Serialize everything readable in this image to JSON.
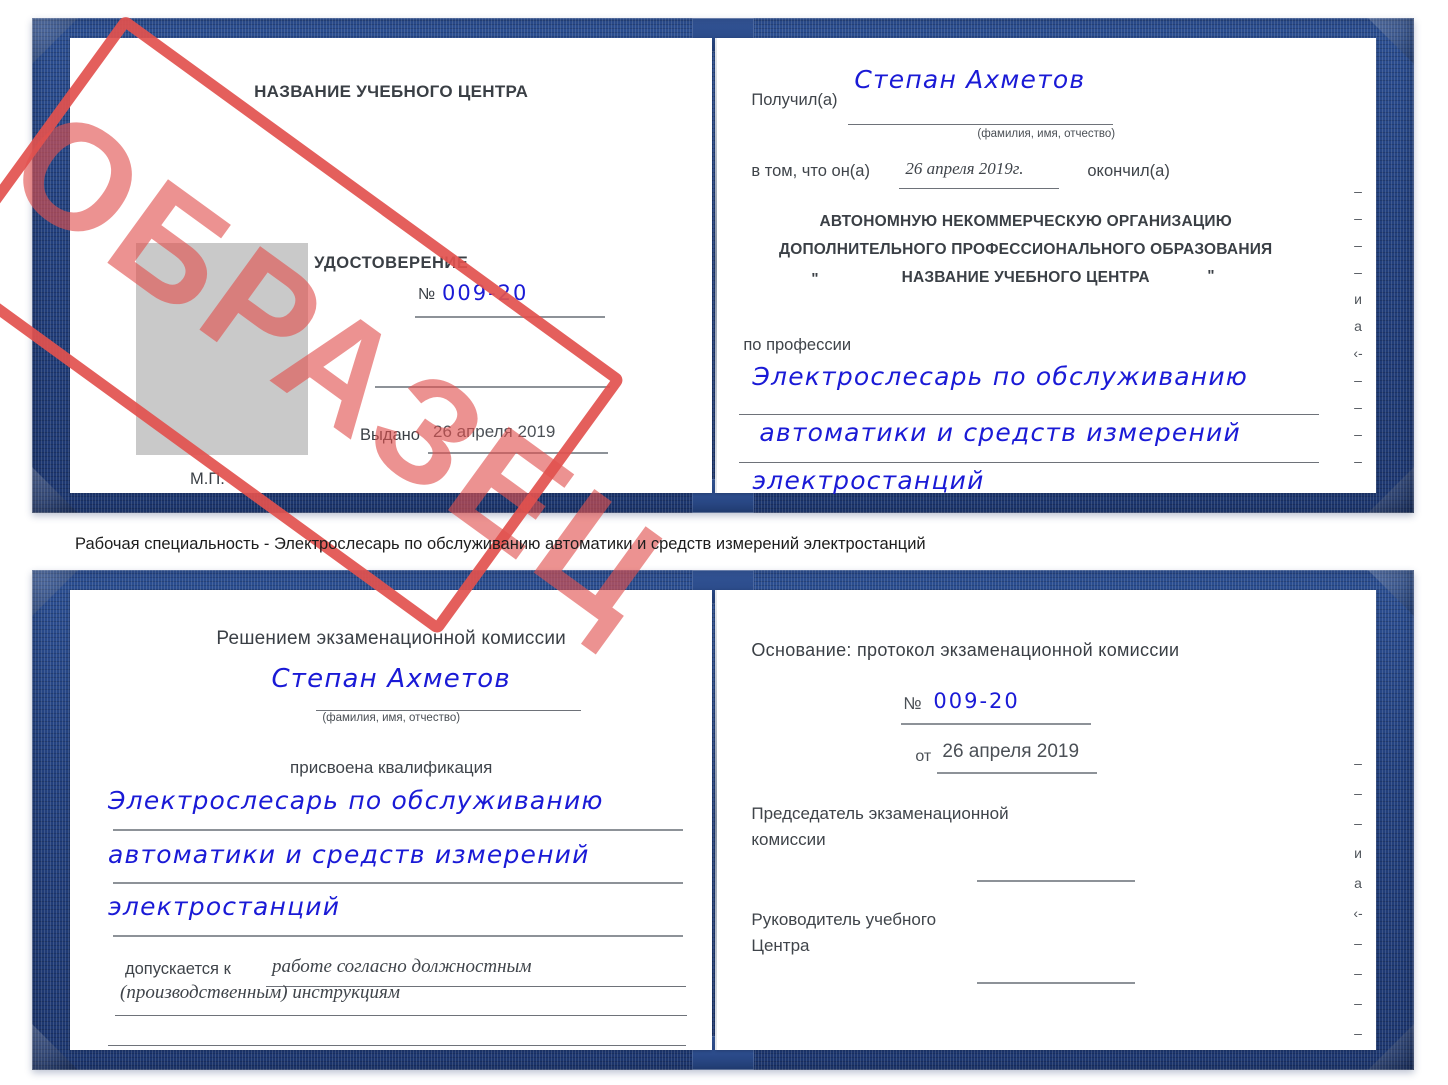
{
  "caption": "Рабочая специальность - Электрослесарь по обслуживанию автоматики и средств измерений электростанций",
  "stamp": {
    "text": "ОБРАЗЕЦ",
    "color": "#e2514e"
  },
  "ink_color": "#1a1ad6",
  "cover_color": "#23417f",
  "certificate_top": {
    "left_page": {
      "org_title": "НАЗВАНИЕ УЧЕБНОГО ЦЕНТРА",
      "doc_type": "УДОСТОВЕРЕНИЕ",
      "number_label": "№",
      "number_value": "009-20",
      "issued_label": "Выдано",
      "issued_value": "26 апреля 2019",
      "seal_label": "М.П."
    },
    "right_page": {
      "received_label": "Получил(а)",
      "received_value": "Степан Ахметов",
      "fio_hint": "(фамилия, имя, отчество)",
      "in_that_label": "в том, что он(а)",
      "in_that_value": "26 апреля 2019г.",
      "finished_label": "окончил(а)",
      "org_line1": "АВТОНОМНУЮ НЕКОММЕРЧЕСКУЮ ОРГАНИЗАЦИЮ",
      "org_line2": "ДОПОЛНИТЕЛЬНОГО ПРОФЕССИОНАЛЬНОГО ОБРАЗОВАНИЯ",
      "org_quote_open": "\"",
      "org_line3": "НАЗВАНИЕ УЧЕБНОГО ЦЕНТРА",
      "org_quote_close": "\"",
      "profession_label": "по профессии",
      "profession_line1": "Электрослесарь по обслуживанию",
      "profession_line2": "автоматики и средств измерений",
      "profession_line3": "электростанций",
      "edge_fragments": [
        "–",
        "–",
        "–",
        "–",
        "и",
        "а",
        "‹-",
        "–",
        "–",
        "–",
        "–",
        "–"
      ]
    }
  },
  "certificate_bottom": {
    "left_page": {
      "title": "Решением экзаменационной комиссии",
      "name_value": "Степан Ахметов",
      "fio_hint": "(фамилия, имя, отчество)",
      "qualification_label": "присвоена квалификация",
      "qualification_line1": "Электрослесарь по обслуживанию",
      "qualification_line2": "автоматики и средств измерений",
      "qualification_line3": "электростанций",
      "admitted_label": "допускается к",
      "admitted_value1": "работе согласно должностным",
      "admitted_value2": "(производственным) инструкциям"
    },
    "right_page": {
      "basis_label": "Основание: протокол экзаменационной комиссии",
      "number_label": "№",
      "number_value": "009-20",
      "date_label": "от",
      "date_value": "26 апреля 2019",
      "chairman_line1": "Председатель экзаменационной",
      "chairman_line2": "комиссии",
      "head_line1": "Руководитель учебного",
      "head_line2": "Центра",
      "edge_fragments": [
        "–",
        "–",
        "–",
        "и",
        "а",
        "‹-",
        "–",
        "–",
        "–",
        "–"
      ]
    }
  }
}
